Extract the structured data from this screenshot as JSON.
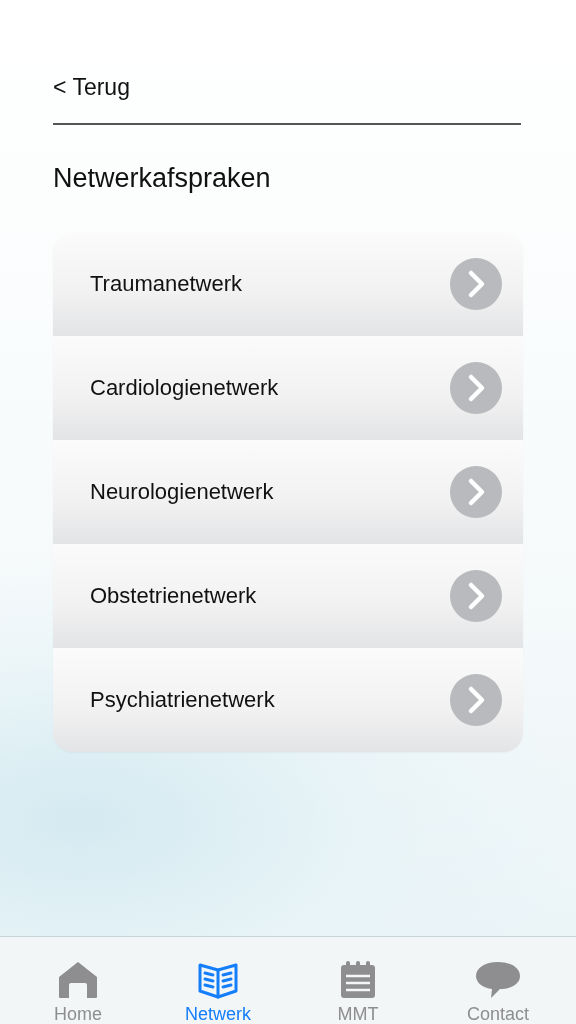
{
  "back_link": "< Terug",
  "title": "Netwerkafspraken",
  "items": [
    {
      "label": "Traumanetwerk"
    },
    {
      "label": "Cardiologienetwerk"
    },
    {
      "label": "Neurologienetwerk"
    },
    {
      "label": "Obstetrienetwerk"
    },
    {
      "label": "Psychiatrienetwerk"
    }
  ],
  "tabs": [
    {
      "label": "Home",
      "kind": "home",
      "selected": false
    },
    {
      "label": "Netwerk",
      "kind": "book",
      "selected": true
    },
    {
      "label": "MMT",
      "kind": "notepad",
      "selected": false
    },
    {
      "label": "Contact",
      "kind": "chat",
      "selected": false
    }
  ]
}
